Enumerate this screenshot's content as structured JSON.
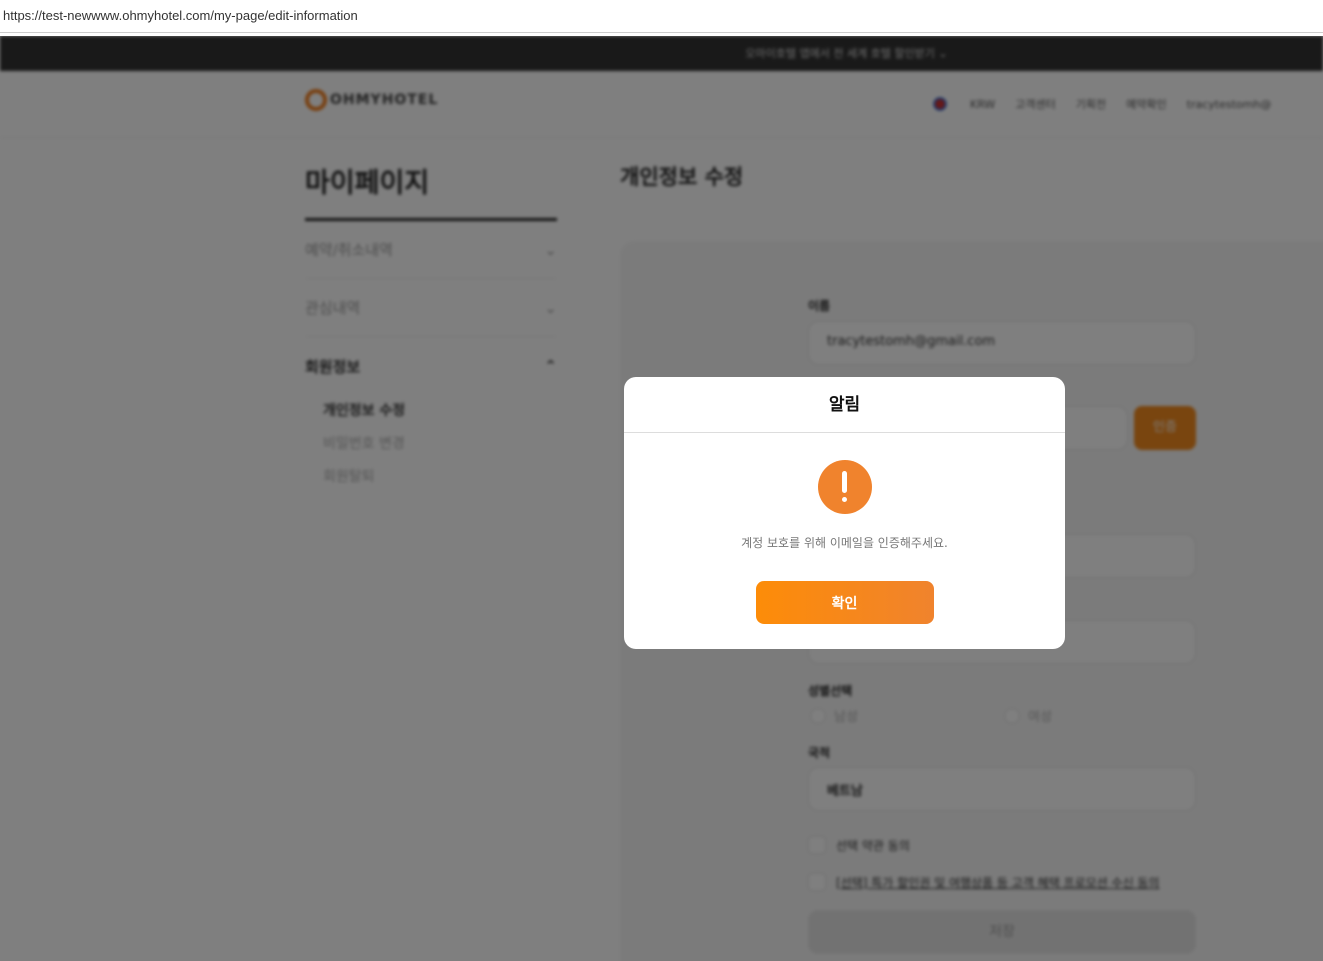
{
  "browser": {
    "url": "https://test-newwww.ohmyhotel.com/my-page/edit-information"
  },
  "banner": {
    "text": "오마이호텔 앱에서 전 세계 호텔 할인받기 ⌄"
  },
  "header": {
    "logo": "OHMYHOTEL",
    "currency": "KRW",
    "nav": [
      "고객센터",
      "기획전",
      "예약확인"
    ],
    "user": "tracytestomh@"
  },
  "sidebar": {
    "title": "마이페이지",
    "items": [
      {
        "label": "예약/취소내역",
        "icon": "⌄"
      },
      {
        "label": "관심내역",
        "icon": "⌄"
      },
      {
        "label": "회원정보",
        "icon": "⌃"
      }
    ],
    "sub": [
      "개인정보 수정",
      "비밀번호 변경",
      "회원탈퇴"
    ]
  },
  "main": {
    "title": "개인정보 수정",
    "name_label": "이름",
    "email_value": "tracytestomh@gmail.com",
    "auth_button": "인증",
    "gender_label": "성별선택",
    "male": "남성",
    "female": "여성",
    "nationality_label": "국적",
    "nationality_value": "베트남",
    "agree_all": "선택 약관 동의",
    "agree_promo": "[선택] 특가 할인권 및 여행상품 등 고객 혜택 프로모션 수신 동의",
    "save": "저장"
  },
  "modal": {
    "title": "알림",
    "message": "계정 보호를 위해 이메일을 인증해주세요.",
    "confirm": "확인",
    "accent": "#f0832d"
  }
}
